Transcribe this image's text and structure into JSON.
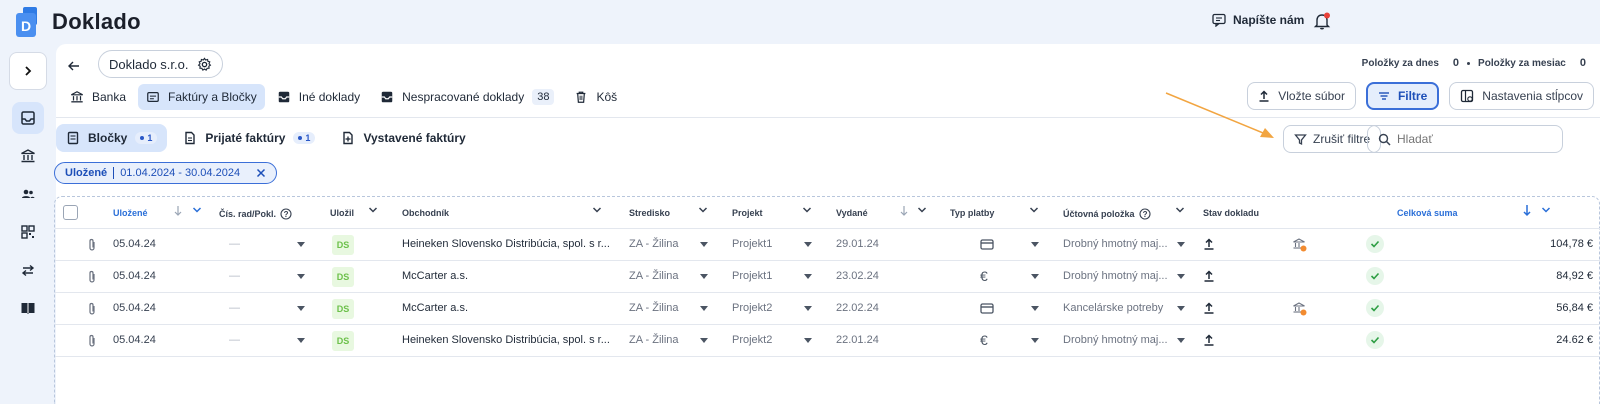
{
  "app": {
    "name": "Doklado"
  },
  "header": {
    "contact_label": "Napíšte nám"
  },
  "company": {
    "name": "Doklado s.r.o."
  },
  "counters": {
    "today_label": "Položky za dnes",
    "today_value": "0",
    "month_label": "Položky za mesiac",
    "month_value": "0"
  },
  "main_tabs": [
    {
      "label": "Banka",
      "icon": "bank-icon"
    },
    {
      "label": "Faktúry a Bločky",
      "icon": "invoice-icon",
      "active": true
    },
    {
      "label": "Iné doklady",
      "icon": "inbox-icon"
    },
    {
      "label": "Nespracované doklady",
      "icon": "inbox-icon",
      "count": "38"
    },
    {
      "label": "Kôš",
      "icon": "trash-icon"
    }
  ],
  "actions": {
    "upload": "Vložte súbor",
    "filter": "Filtre",
    "columns": "Nastavenia stĺpcov"
  },
  "sub_tabs": [
    {
      "label": "Bločky",
      "badge": "1",
      "active": true
    },
    {
      "label": "Prijaté faktúry",
      "badge": "1"
    },
    {
      "label": "Vystavené faktúry"
    }
  ],
  "clear_filter": "Zrušiť filtre",
  "search": {
    "placeholder": "Hladať"
  },
  "filter_chip": {
    "field": "Uložené",
    "value": "01.04.2024 - 30.04.2024"
  },
  "columns": {
    "saved": "Uložené",
    "number": "Čís. rad/Pokl.",
    "saved_by": "Uložil",
    "merchant": "Obchodník",
    "center": "Stredisko",
    "project": "Projekt",
    "issued": "Vydané",
    "payment": "Typ platby",
    "account": "Účtovná položka",
    "status": "Stav dokladu",
    "total": "Celková suma"
  },
  "rows": [
    {
      "saved": "05.04.24",
      "number": "—",
      "saved_by": "DS",
      "merchant": "Heineken Slovensko Distribúcia, spol. s r...",
      "center": "ZA - Žilina",
      "project": "Projekt1",
      "issued": "29.01.24",
      "payment": "card",
      "account": "Drobný hmotný maj...",
      "flag": true,
      "total": "104,78 €"
    },
    {
      "saved": "05.04.24",
      "number": "—",
      "saved_by": "DS",
      "merchant": "McCarter a.s.",
      "center": "ZA - Žilina",
      "project": "Projekt1",
      "issued": "23.02.24",
      "payment": "cash",
      "account": "Drobný hmotný maj...",
      "flag": false,
      "total": "84,92 €"
    },
    {
      "saved": "05.04.24",
      "number": "—",
      "saved_by": "DS",
      "merchant": "McCarter a.s.",
      "center": "ZA - Žilina",
      "project": "Projekt2",
      "issued": "22.02.24",
      "payment": "card",
      "account": "Kancelárske potreby",
      "flag": true,
      "total": "56,84 €"
    },
    {
      "saved": "05.04.24",
      "number": "—",
      "saved_by": "DS",
      "merchant": "Heineken Slovensko Distribúcia, spol. s r...",
      "center": "ZA - Žilina",
      "project": "Projekt2",
      "issued": "22.01.24",
      "payment": "cash",
      "account": "Drobný hmotný maj...",
      "flag": false,
      "total": "24.62 €"
    }
  ],
  "colors": {
    "accent": "#3b6fd8",
    "active_bg": "#d7e5fb",
    "annotation_arrow": "#f2a541",
    "ok_green": "#2e9e44"
  }
}
